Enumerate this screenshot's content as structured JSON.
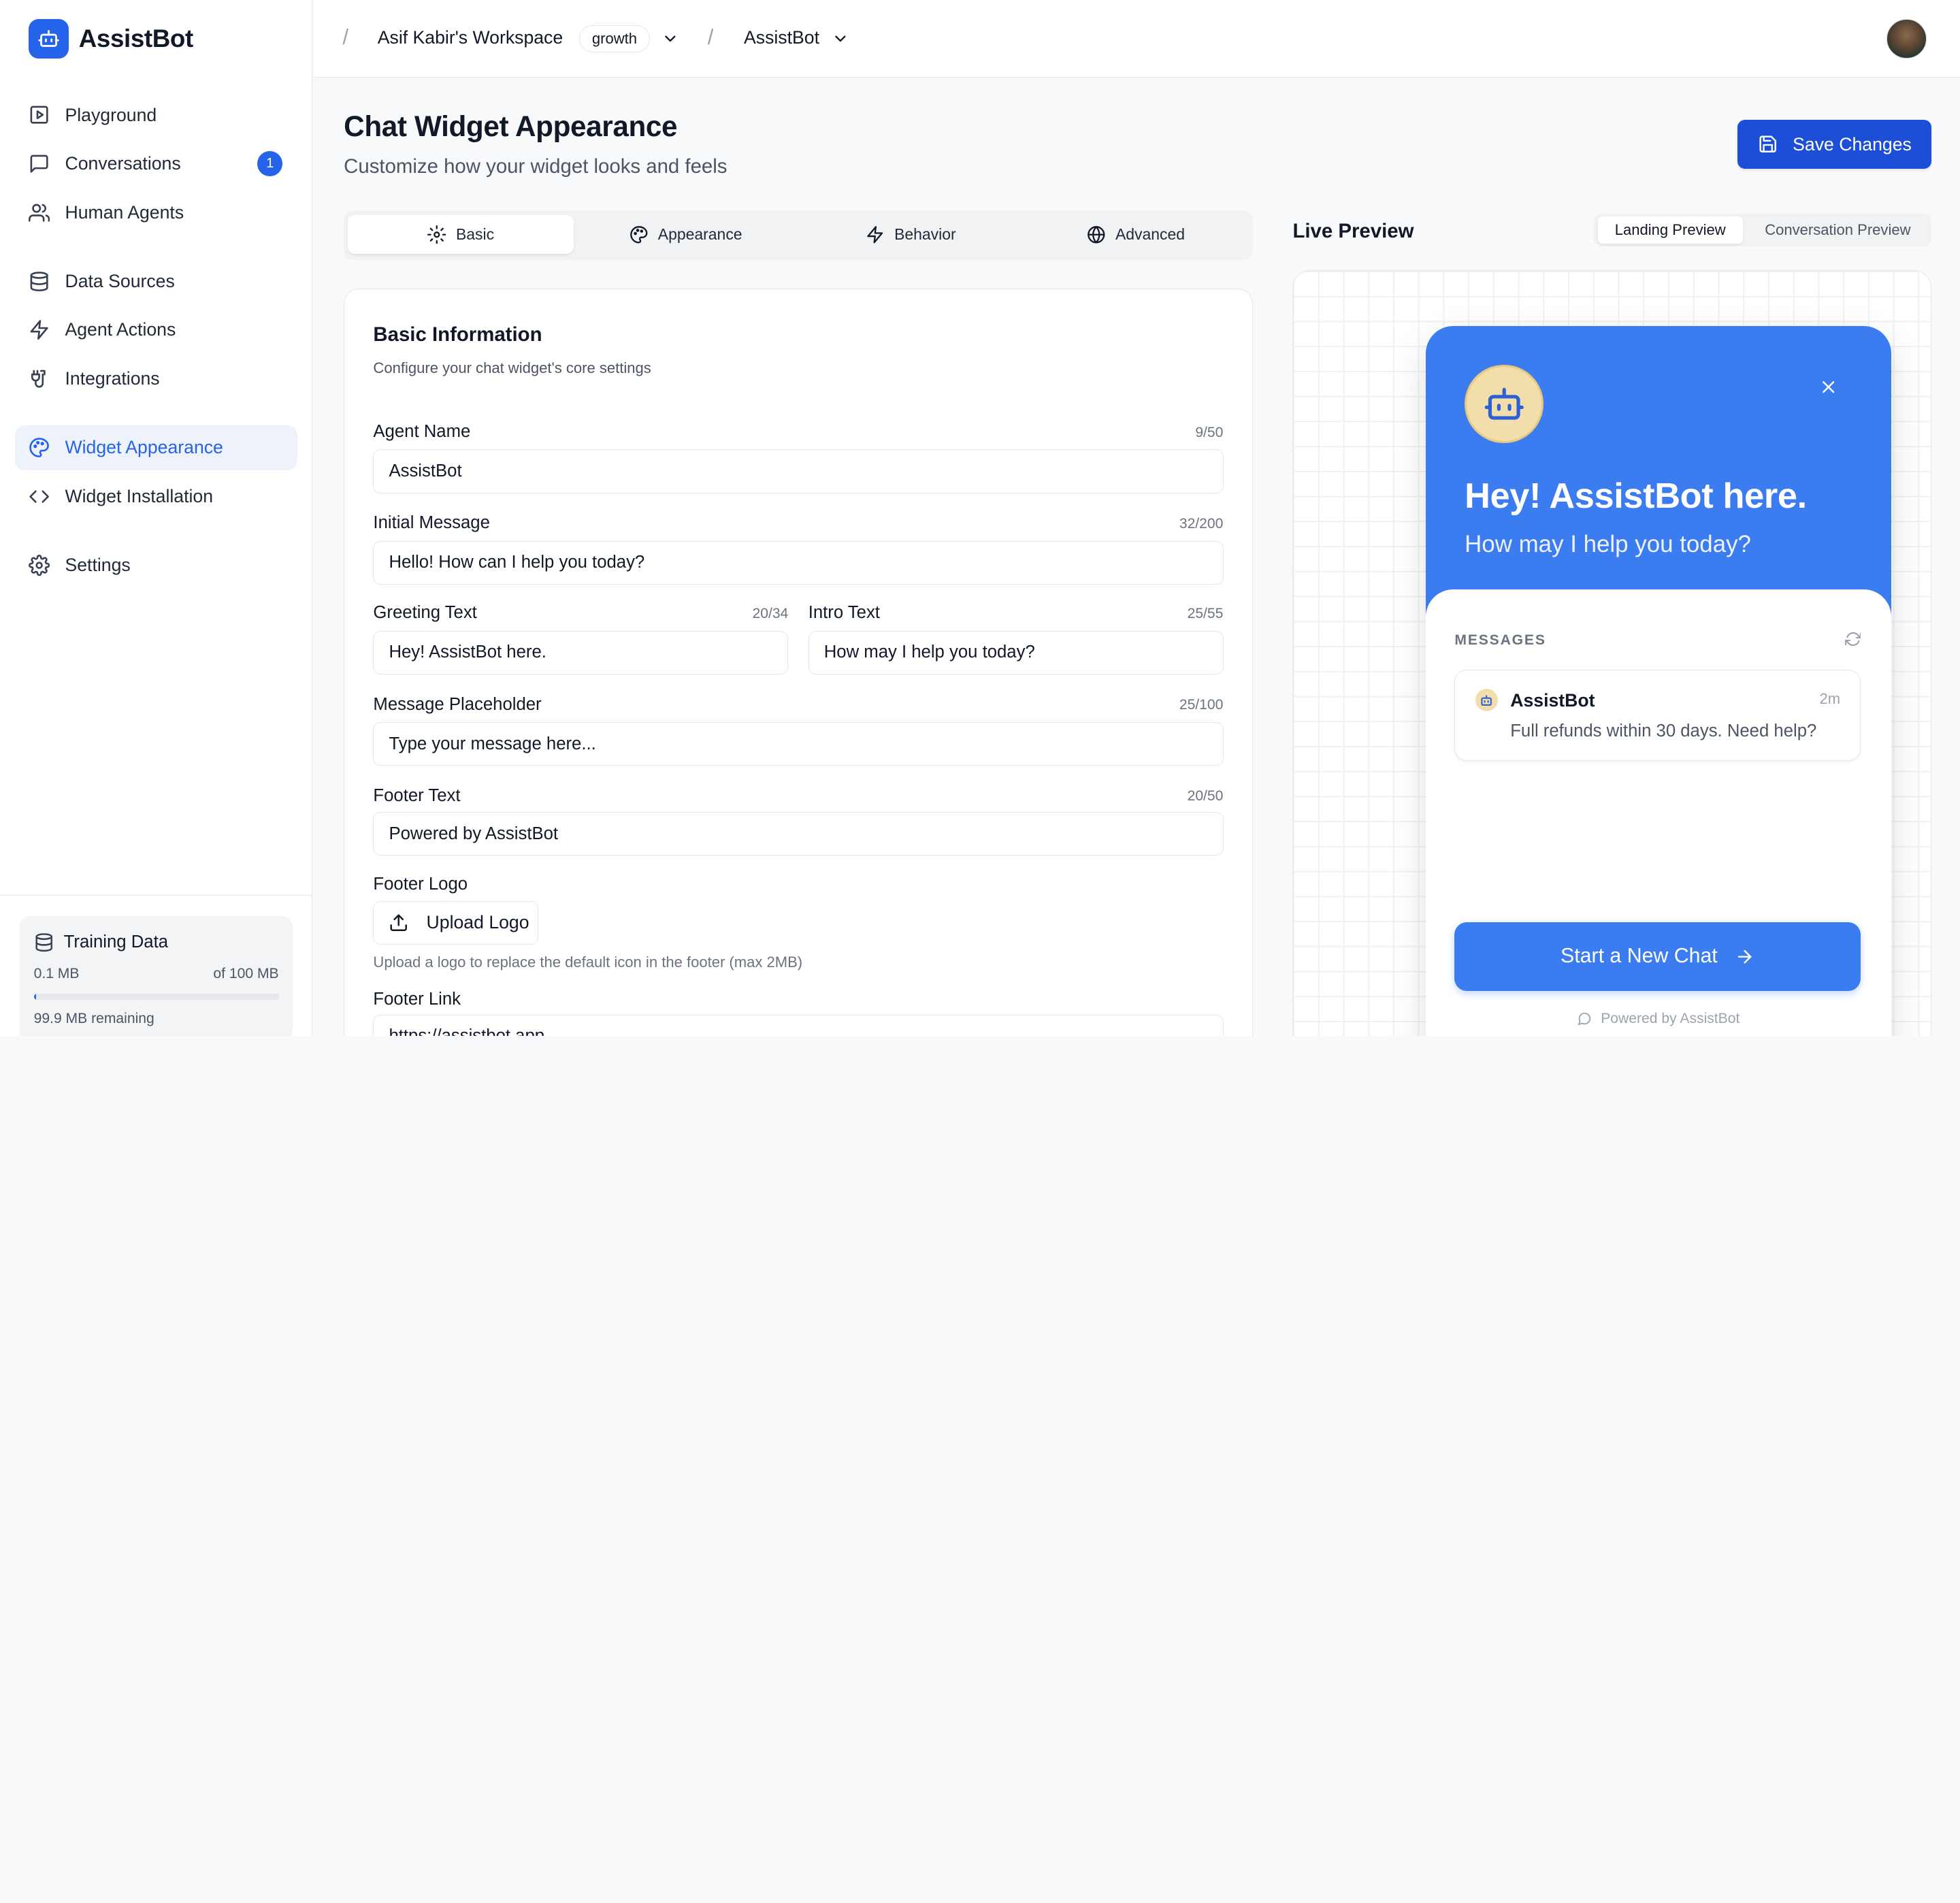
{
  "sidebar": {
    "brand": "AssistBot",
    "nav": [
      {
        "label": "Playground"
      },
      {
        "label": "Conversations",
        "badge": "1"
      },
      {
        "label": "Human Agents"
      },
      {
        "label": "Data Sources"
      },
      {
        "label": "Agent Actions"
      },
      {
        "label": "Integrations"
      },
      {
        "label": "Widget Appearance",
        "active": true
      },
      {
        "label": "Widget Installation"
      },
      {
        "label": "Settings"
      }
    ],
    "training": {
      "title": "Training Data",
      "used": "0.1 MB",
      "total": "of 100 MB",
      "used_fraction": 0.001,
      "remaining": "99.9 MB remaining"
    }
  },
  "topbar": {
    "workspace": "Asif Kabir's Workspace",
    "plan": "growth",
    "bot": "AssistBot"
  },
  "header": {
    "title": "Chat Widget Appearance",
    "subtitle": "Customize how your widget looks and feels",
    "save_label": "Save Changes"
  },
  "tabs": [
    {
      "label": "Basic",
      "active": true
    },
    {
      "label": "Appearance"
    },
    {
      "label": "Behavior"
    },
    {
      "label": "Advanced"
    }
  ],
  "form": {
    "title": "Basic Information",
    "subtitle": "Configure your chat widget's core settings",
    "agent_name": {
      "label": "Agent Name",
      "count": "9/50",
      "value": "AssistBot"
    },
    "initial_message": {
      "label": "Initial Message",
      "count": "32/200",
      "value": "Hello! How can I help you today?"
    },
    "greeting_text": {
      "label": "Greeting Text",
      "count": "20/34",
      "value": "Hey! AssistBot here."
    },
    "intro_text": {
      "label": "Intro Text",
      "count": "25/55",
      "value": "How may I help you today?"
    },
    "placeholder": {
      "label": "Message Placeholder",
      "count": "25/100",
      "value": "Type your message here..."
    },
    "footer_text": {
      "label": "Footer Text",
      "count": "20/50",
      "value": "Powered by AssistBot"
    },
    "footer_logo": {
      "label": "Footer Logo",
      "button": "Upload Logo",
      "hint": "Upload a logo to replace the default icon in the footer (max 2MB)"
    },
    "footer_link": {
      "label": "Footer Link",
      "value": "https://assistbot.app"
    }
  },
  "preview": {
    "title": "Live Preview",
    "tabs": [
      {
        "label": "Landing Preview",
        "active": true
      },
      {
        "label": "Conversation Preview"
      }
    ],
    "widget": {
      "greeting": "Hey! AssistBot here.",
      "intro": "How may I help you today?",
      "messages_label": "MESSAGES",
      "message": {
        "name": "AssistBot",
        "time": "2m",
        "text": "Full refunds within 30 days. Need help?"
      },
      "start_button": "Start a New Chat",
      "powered": "Powered by AssistBot"
    }
  },
  "colors": {
    "accent": "#2563eb",
    "widget_header": "#3b7cf0",
    "avatar_bg": "#f2deaa"
  }
}
